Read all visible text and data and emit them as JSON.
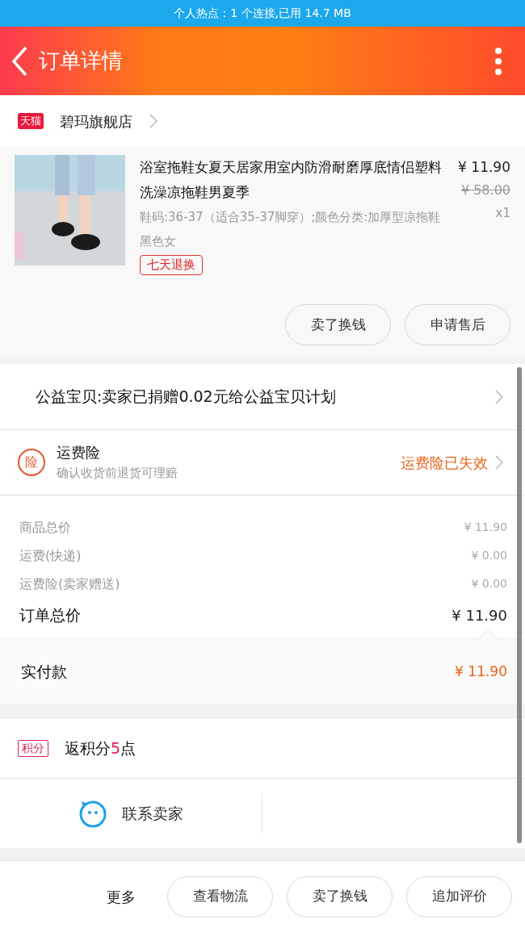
{
  "status_bar": {
    "text": "个人热点：1 个连接,已用 14.7 MB"
  },
  "header": {
    "title": "订单详情"
  },
  "store": {
    "badge": "天猫",
    "name": "碧玛旗舰店"
  },
  "product": {
    "title": "浴室拖鞋女夏天居家用室内防滑耐磨厚底情侣塑料洗澡凉拖鞋男夏季",
    "sku": "鞋码:36-37（适合35-37脚穿）;颜色分类:加厚型凉拖鞋黑色女",
    "tag": "七天退换",
    "price": "¥ 11.90",
    "original_price": "¥ 58.00",
    "quantity": "x1",
    "actions": [
      "卖了换钱",
      "申请售后"
    ]
  },
  "charity": {
    "text": "公益宝贝:卖家已捐赠0.02元给公益宝贝计划"
  },
  "insurance": {
    "icon_text": "险",
    "title": "运费险",
    "subtitle": "确认收货前退货可理赔",
    "status": "运费险已失效"
  },
  "price_lines": [
    {
      "label": "商品总价",
      "value": "¥ 11.90",
      "kind": "minor"
    },
    {
      "label": "运费(快递)",
      "value": "¥ 0.00",
      "kind": "minor"
    },
    {
      "label": "运费险(卖家赠送)",
      "value": "¥ 0.00",
      "kind": "minor"
    },
    {
      "label": "订单总价",
      "value": "¥ 11.90",
      "kind": "total"
    }
  ],
  "paid": {
    "label": "实付款",
    "value": "¥ 11.90"
  },
  "points": {
    "badge": "积分",
    "text_before": "返积分",
    "count": "5",
    "text_after": "点"
  },
  "contact": {
    "label": "联系卖家"
  },
  "bottom_bar": {
    "more": "更多",
    "buttons": [
      "查看物流",
      "卖了换钱",
      "追加评价"
    ]
  }
}
